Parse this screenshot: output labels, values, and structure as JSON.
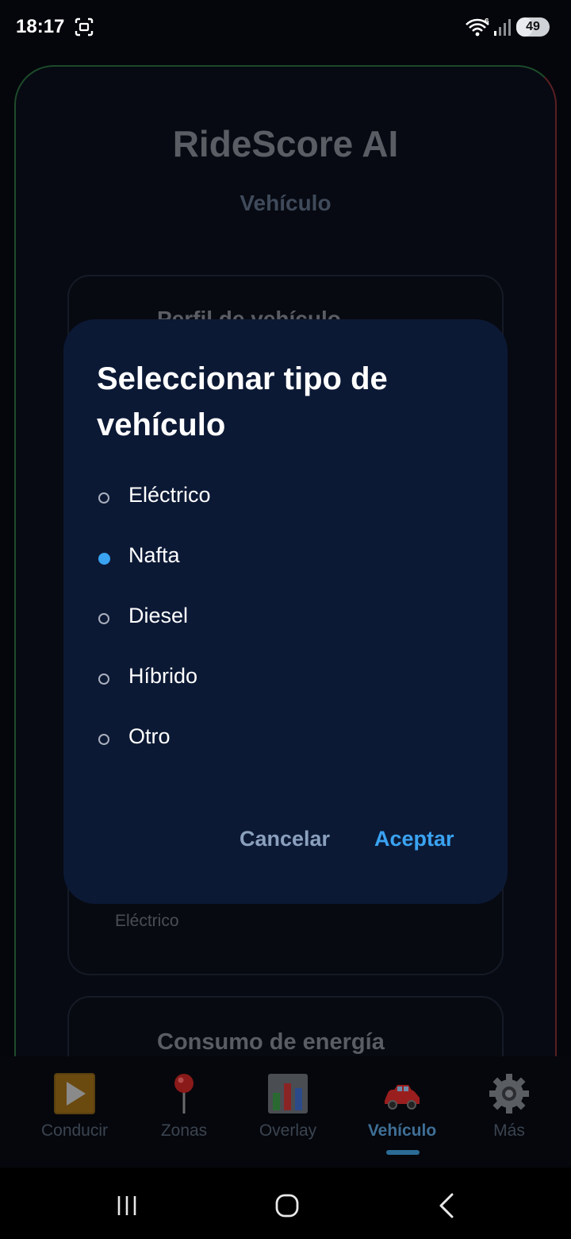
{
  "status_bar": {
    "time": "18:17",
    "battery_level": "49",
    "battery_fraction": 0.49
  },
  "app": {
    "title": "RideScore AI",
    "section": "Vehículo",
    "profile_card": {
      "title": "Perfil de vehículo",
      "value": "Eléctrico"
    },
    "energy_card": {
      "title": "Consumo de energía"
    }
  },
  "dialog": {
    "title": "Seleccionar tipo de vehículo",
    "options": [
      "Eléctrico",
      "Nafta",
      "Diesel",
      "Híbrido",
      "Otro"
    ],
    "selected_option": "Nafta",
    "cancel_label": "Cancelar",
    "accept_label": "Aceptar"
  },
  "bottom_nav": {
    "items": [
      {
        "label": "Conducir",
        "icon": "play-icon"
      },
      {
        "label": "Zonas",
        "icon": "pushpin-icon"
      },
      {
        "label": "Overlay",
        "icon": "bar-chart-icon"
      },
      {
        "label": "Vehículo",
        "icon": "car-icon"
      },
      {
        "label": "Más",
        "icon": "gear-icon"
      }
    ],
    "active": "Vehículo"
  },
  "system_nav": {
    "buttons": [
      "recents-icon",
      "home-icon",
      "back-icon"
    ]
  },
  "colors": {
    "accent": "#3aa3f2",
    "dialog_bg": "#0c1935",
    "cancel": "#8aa0bd"
  }
}
